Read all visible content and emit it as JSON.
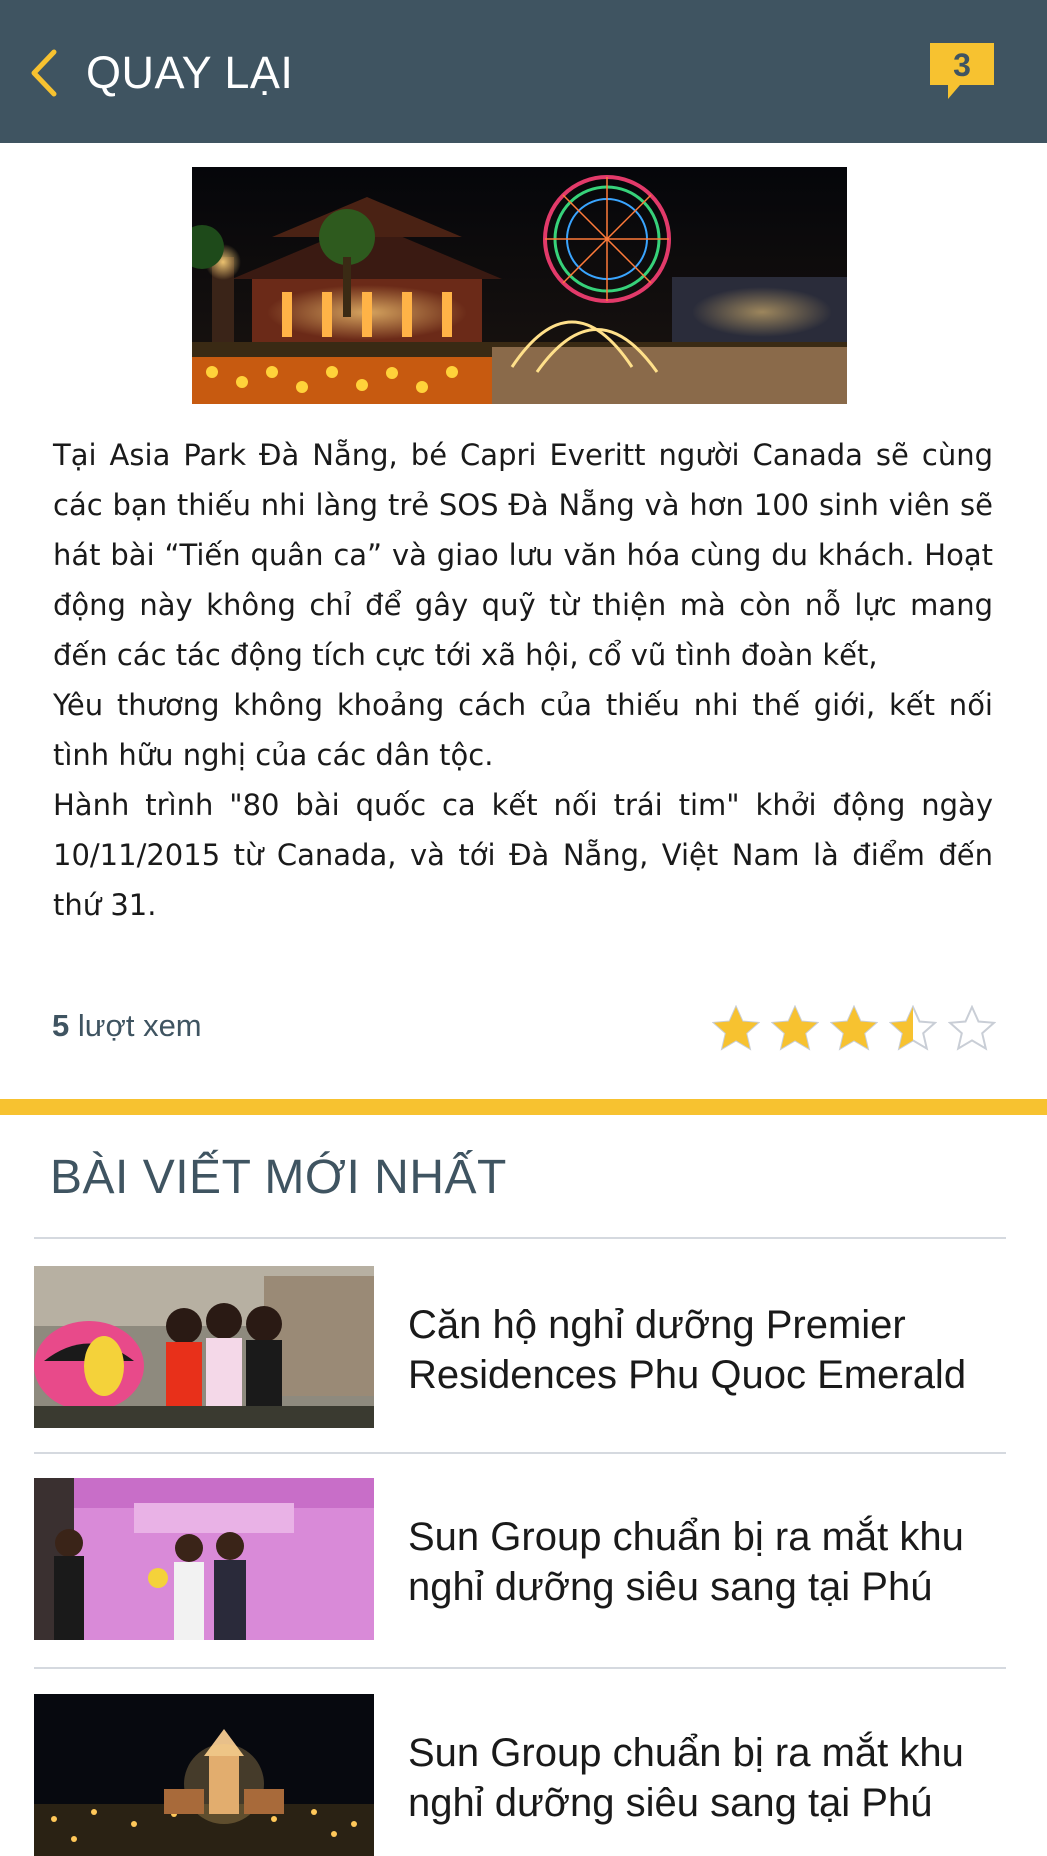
{
  "header": {
    "back_label": "QUAY LẠI",
    "comment_count": "3",
    "background": "#3f5461",
    "accent": "#f7c230"
  },
  "article": {
    "paragraphs": [
      "Tại Asia Park Đà Nẵng, bé Capri Everitt người Canada sẽ cùng các bạn thiếu nhi làng trẻ SOS Đà Nẵng và hơn 100 sinh viên sẽ hát bài “Tiến quân ca” và giao lưu văn hóa cùng du khách. Hoạt động này không chỉ để gây quỹ từ thiện mà còn nỗ lực mang đến các tác động tích cực tới xã hội, cổ vũ tình đoàn kết,",
      "Yêu thương không khoảng cách của thiếu nhi thế giới, kết nối tình hữu nghị của các dân tộc.",
      "Hành trình \"80 bài quốc ca kết nối trái tim\" khởi động ngày 10/11/2015 từ Canada, và tới Đà Nẵng, Việt Nam là điểm đến thứ 31."
    ],
    "views_count": "5",
    "views_label": "lượt xem",
    "rating": 3.5,
    "rating_max": 5
  },
  "latest": {
    "title": "BÀI VIẾT MỚI NHẤT",
    "items": [
      {
        "title": "Căn hộ nghỉ dưỡng Premier Residences Phu Quoc Emerald"
      },
      {
        "title": "Sun Group chuẩn bị ra mắt khu nghỉ dưỡng siêu sang tại Phú"
      },
      {
        "title": "Sun Group chuẩn bị ra mắt khu nghỉ dưỡng siêu sang tại Phú"
      }
    ]
  },
  "icons": {
    "back": "chevron-left-icon",
    "comment": "comment-bubble-icon",
    "star": "star-icon"
  }
}
